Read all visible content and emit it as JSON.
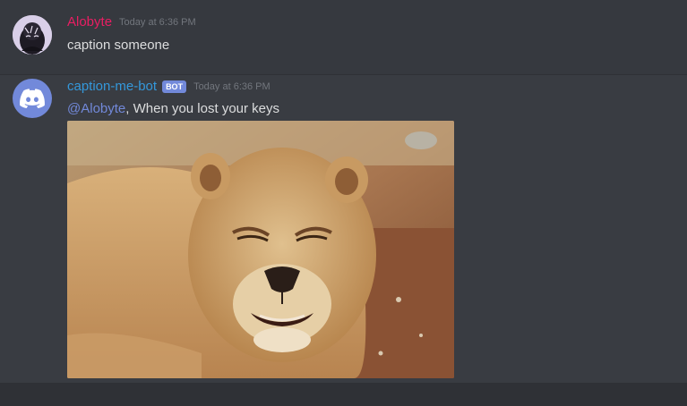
{
  "messages": [
    {
      "username": "Alobyte",
      "timestamp": "Today at 6:36 PM",
      "text": "caption someone",
      "avatar_icon": "user-avatar-icon",
      "name_color": "#e91e63"
    },
    {
      "username": "caption-me-bot",
      "badge": "BOT",
      "timestamp": "Today at 6:36 PM",
      "mention": "@Alobyte",
      "text": ", When you lost your keys",
      "avatar_icon": "discord-logo-icon",
      "name_color": "#3498db",
      "attachment_icon": "lioness-photo"
    }
  ],
  "colors": {
    "background": "#36393f",
    "mention": "#7289da",
    "text": "#dcddde",
    "timestamp": "#72767d"
  }
}
